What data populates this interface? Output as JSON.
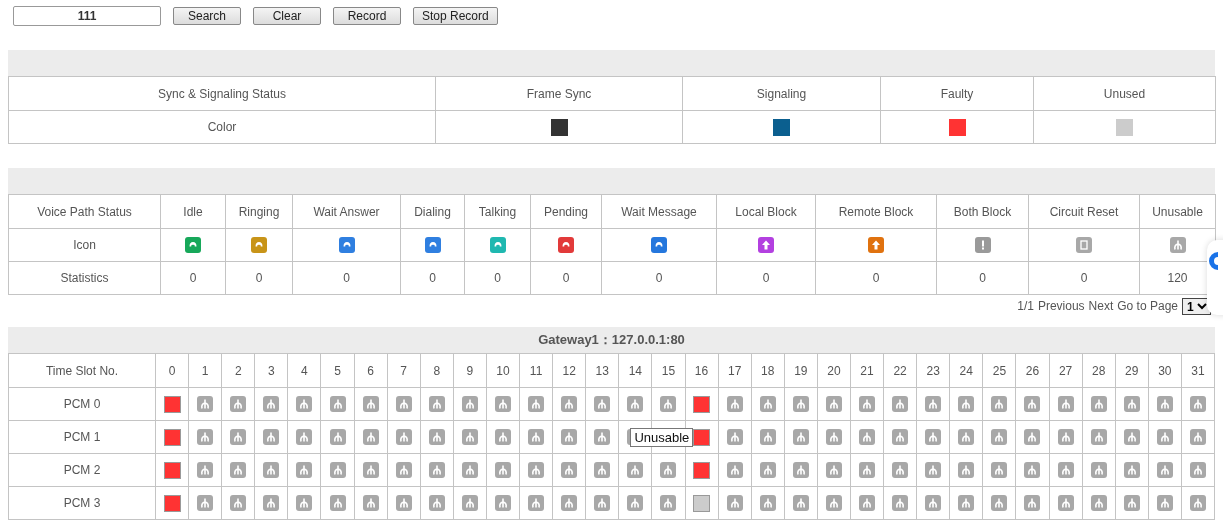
{
  "search": {
    "value": "111"
  },
  "buttons": [
    "Search",
    "Clear",
    "Record",
    "Stop Record"
  ],
  "sync_table": {
    "header": "Sync & Signaling Status",
    "row_label": "Color",
    "statuses": [
      {
        "label": "Frame Sync",
        "color": "#333333"
      },
      {
        "label": "Signaling",
        "color": "#0b5f8f"
      },
      {
        "label": "Faulty",
        "color": "#ff3333"
      },
      {
        "label": "Unused",
        "color": "#cccccc"
      }
    ]
  },
  "voice_table": {
    "header": "Voice Path Status",
    "icon_label": "Icon",
    "stats_label": "Statistics",
    "statuses": [
      {
        "label": "Idle",
        "kind": "phone",
        "color": "#17a85a",
        "count": "0"
      },
      {
        "label": "Ringing",
        "kind": "phone",
        "color": "#c89418",
        "count": "0"
      },
      {
        "label": "Wait Answer",
        "kind": "phone",
        "color": "#2f7fe0",
        "count": "0"
      },
      {
        "label": "Dialing",
        "kind": "phone",
        "color": "#2f7fe0",
        "count": "0"
      },
      {
        "label": "Talking",
        "kind": "phone",
        "color": "#1fb8b0",
        "count": "0"
      },
      {
        "label": "Pending",
        "kind": "phone",
        "color": "#e23a3a",
        "count": "0"
      },
      {
        "label": "Wait Message",
        "kind": "phone",
        "color": "#2577dd",
        "count": "0"
      },
      {
        "label": "Local Block",
        "kind": "block",
        "color": "#b340e0",
        "count": "0"
      },
      {
        "label": "Remote Block",
        "kind": "block",
        "color": "#e0720f",
        "count": "0"
      },
      {
        "label": "Both Block",
        "kind": "alert",
        "color": "#9a9a9a",
        "count": "0"
      },
      {
        "label": "Circuit Reset",
        "kind": "reset",
        "color": "#a8a8a8",
        "count": "0"
      },
      {
        "label": "Unusable",
        "kind": "unusable",
        "color": "#a8a8a8",
        "count": "120"
      }
    ]
  },
  "pagination": {
    "summary": "1/1",
    "previous": "Previous",
    "next": "Next",
    "goto": "Go to Page",
    "page": "1"
  },
  "gateway": {
    "title": "Gateway1：127.0.0.1:80",
    "header": "Time Slot No.",
    "slots": [
      "0",
      "1",
      "2",
      "3",
      "4",
      "5",
      "6",
      "7",
      "8",
      "9",
      "10",
      "11",
      "12",
      "13",
      "14",
      "15",
      "16",
      "17",
      "18",
      "19",
      "20",
      "21",
      "22",
      "23",
      "24",
      "25",
      "26",
      "27",
      "28",
      "29",
      "30",
      "31"
    ],
    "rows": [
      {
        "name": "PCM 0",
        "slots": [
          {
            "kind": "faulty"
          },
          {
            "kind": "unusable"
          },
          {
            "kind": "unusable"
          },
          {
            "kind": "unusable"
          },
          {
            "kind": "unusable"
          },
          {
            "kind": "unusable"
          },
          {
            "kind": "unusable"
          },
          {
            "kind": "unusable"
          },
          {
            "kind": "unusable"
          },
          {
            "kind": "unusable"
          },
          {
            "kind": "unusable"
          },
          {
            "kind": "unusable"
          },
          {
            "kind": "unusable"
          },
          {
            "kind": "unusable"
          },
          {
            "kind": "unusable"
          },
          {
            "kind": "unusable"
          },
          {
            "kind": "faulty"
          },
          {
            "kind": "unusable"
          },
          {
            "kind": "unusable"
          },
          {
            "kind": "unusable"
          },
          {
            "kind": "unusable"
          },
          {
            "kind": "unusable"
          },
          {
            "kind": "unusable"
          },
          {
            "kind": "unusable"
          },
          {
            "kind": "unusable"
          },
          {
            "kind": "unusable"
          },
          {
            "kind": "unusable"
          },
          {
            "kind": "unusable"
          },
          {
            "kind": "unusable"
          },
          {
            "kind": "unusable"
          },
          {
            "kind": "unusable"
          },
          {
            "kind": "unusable"
          }
        ]
      },
      {
        "name": "PCM 1",
        "slots": [
          {
            "kind": "faulty"
          },
          {
            "kind": "unusable"
          },
          {
            "kind": "unusable"
          },
          {
            "kind": "unusable"
          },
          {
            "kind": "unusable"
          },
          {
            "kind": "unusable"
          },
          {
            "kind": "unusable"
          },
          {
            "kind": "unusable"
          },
          {
            "kind": "unusable"
          },
          {
            "kind": "unusable"
          },
          {
            "kind": "unusable"
          },
          {
            "kind": "unusable"
          },
          {
            "kind": "unusable"
          },
          {
            "kind": "unusable"
          },
          {
            "kind": "unusable"
          },
          {
            "kind": "hovered",
            "tooltip": "Unusable"
          },
          {
            "kind": "faulty"
          },
          {
            "kind": "unusable"
          },
          {
            "kind": "unusable"
          },
          {
            "kind": "unusable"
          },
          {
            "kind": "unusable"
          },
          {
            "kind": "unusable"
          },
          {
            "kind": "unusable"
          },
          {
            "kind": "unusable"
          },
          {
            "kind": "unusable"
          },
          {
            "kind": "unusable"
          },
          {
            "kind": "unusable"
          },
          {
            "kind": "unusable"
          },
          {
            "kind": "unusable"
          },
          {
            "kind": "unusable"
          },
          {
            "kind": "unusable"
          },
          {
            "kind": "unusable"
          }
        ]
      },
      {
        "name": "PCM 2",
        "slots": [
          {
            "kind": "faulty"
          },
          {
            "kind": "unusable"
          },
          {
            "kind": "unusable"
          },
          {
            "kind": "unusable"
          },
          {
            "kind": "unusable"
          },
          {
            "kind": "unusable"
          },
          {
            "kind": "unusable"
          },
          {
            "kind": "unusable"
          },
          {
            "kind": "unusable"
          },
          {
            "kind": "unusable"
          },
          {
            "kind": "unusable"
          },
          {
            "kind": "unusable"
          },
          {
            "kind": "unusable"
          },
          {
            "kind": "unusable"
          },
          {
            "kind": "unusable"
          },
          {
            "kind": "unusable"
          },
          {
            "kind": "faulty"
          },
          {
            "kind": "unusable"
          },
          {
            "kind": "unusable"
          },
          {
            "kind": "unusable"
          },
          {
            "kind": "unusable"
          },
          {
            "kind": "unusable"
          },
          {
            "kind": "unusable"
          },
          {
            "kind": "unusable"
          },
          {
            "kind": "unusable"
          },
          {
            "kind": "unusable"
          },
          {
            "kind": "unusable"
          },
          {
            "kind": "unusable"
          },
          {
            "kind": "unusable"
          },
          {
            "kind": "unusable"
          },
          {
            "kind": "unusable"
          },
          {
            "kind": "unusable"
          }
        ]
      },
      {
        "name": "PCM 3",
        "slots": [
          {
            "kind": "faulty"
          },
          {
            "kind": "unusable"
          },
          {
            "kind": "unusable"
          },
          {
            "kind": "unusable"
          },
          {
            "kind": "unusable"
          },
          {
            "kind": "unusable"
          },
          {
            "kind": "unusable"
          },
          {
            "kind": "unusable"
          },
          {
            "kind": "unusable"
          },
          {
            "kind": "unusable"
          },
          {
            "kind": "unusable"
          },
          {
            "kind": "unusable"
          },
          {
            "kind": "unusable"
          },
          {
            "kind": "unusable"
          },
          {
            "kind": "unusable"
          },
          {
            "kind": "unusable"
          },
          {
            "kind": "unused"
          },
          {
            "kind": "unusable"
          },
          {
            "kind": "unusable"
          },
          {
            "kind": "unusable"
          },
          {
            "kind": "unusable"
          },
          {
            "kind": "unusable"
          },
          {
            "kind": "unusable"
          },
          {
            "kind": "unusable"
          },
          {
            "kind": "unusable"
          },
          {
            "kind": "unusable"
          },
          {
            "kind": "unusable"
          },
          {
            "kind": "unusable"
          },
          {
            "kind": "unusable"
          },
          {
            "kind": "unusable"
          },
          {
            "kind": "unusable"
          },
          {
            "kind": "unusable"
          }
        ]
      }
    ]
  }
}
